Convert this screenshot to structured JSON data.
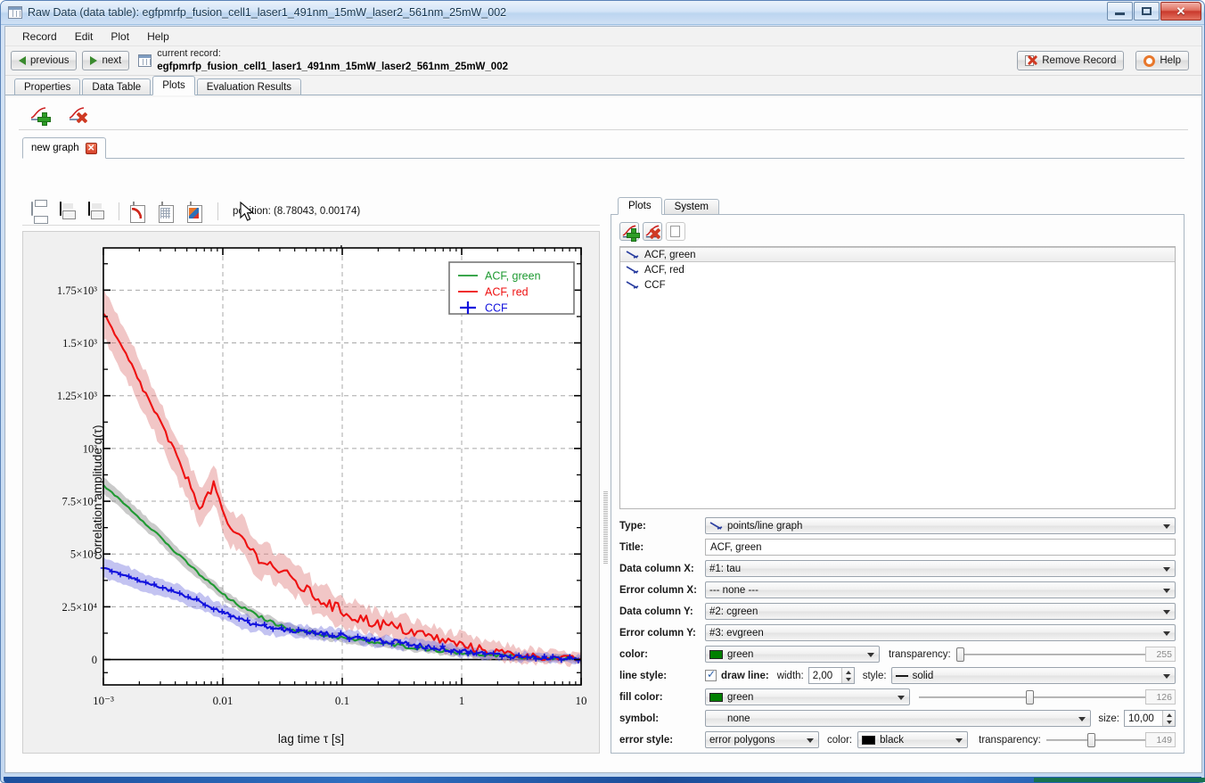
{
  "window": {
    "title": "Raw Data (data table): egfpmrfp_fusion_cell1_laser1_491nm_15mW_laser2_561nm_25mW_002",
    "minimize_label": "",
    "maximize_label": "",
    "close_label": "✕"
  },
  "menu": {
    "items": [
      "Record",
      "Edit",
      "Plot",
      "Help"
    ]
  },
  "record_bar": {
    "previous_label": "previous",
    "next_label": "next",
    "current_record_caption": "current record:",
    "current_record_name": "egfpmrfp_fusion_cell1_laser1_491nm_15mW_laser2_561nm_25mW_002",
    "remove_record_label": "Remove Record",
    "help_label": "Help"
  },
  "main_tabs": {
    "items": [
      "Properties",
      "Data Table",
      "Plots",
      "Evaluation Results"
    ],
    "active": "Plots"
  },
  "graph_tab": {
    "label": "new graph",
    "close_label": "✕"
  },
  "graph_toolbar": {
    "position_text": "position: (8.78043, 0.00174)",
    "icons": [
      "print-icon",
      "save-icon",
      "save-table-icon",
      "copy-graph-icon",
      "copy-table-icon",
      "copy-matlab-icon"
    ]
  },
  "right_tabs": {
    "items": [
      "Plots",
      "System"
    ],
    "active": "Plots"
  },
  "plot_list": {
    "items": [
      {
        "label": "ACF, green",
        "selected": true
      },
      {
        "label": "ACF, red",
        "selected": false
      },
      {
        "label": "CCF",
        "selected": false
      }
    ]
  },
  "form": {
    "type": {
      "label": "Type:",
      "value": "points/line graph"
    },
    "title": {
      "label": "Title:",
      "value": "ACF, green"
    },
    "data_column_x": {
      "label": "Data column X:",
      "value": "#1: tau"
    },
    "error_column_x": {
      "label": "Error column X:",
      "value": "--- none ---"
    },
    "data_column_y": {
      "label": "Data column Y:",
      "value": "#2: cgreen"
    },
    "error_column_y": {
      "label": "Error column Y:",
      "value": "#3: evgreen"
    },
    "color": {
      "label": "color:",
      "value": "green",
      "hex": "#008000"
    },
    "color_transparency": {
      "label": "transparency:",
      "value": "255",
      "percent": 2
    },
    "line_style": {
      "label": "line style:",
      "draw_line_label": "draw line:",
      "draw_line_checked": true,
      "width_label": "width:",
      "width_value": "2,00",
      "style_label": "style:",
      "style_value": "solid"
    },
    "fill_color": {
      "label": "fill color:",
      "value": "green",
      "hex": "#008000",
      "alpha": "126",
      "percent": 49
    },
    "symbol": {
      "label": "symbol:",
      "value": "none",
      "size_label": "size:",
      "size_value": "10,00"
    },
    "error_style": {
      "label": "error style:",
      "value": "error polygons",
      "color_label": "color:",
      "color_value": "black",
      "color_hex": "#000000",
      "transparency_label": "transparency:",
      "transparency_value": "149",
      "percent": 45
    }
  },
  "chart_data": {
    "type": "line",
    "title": "new graph",
    "xlabel": "lag time τ [s]",
    "ylabel": "correlation amplitude g(τ)",
    "xscale": "log",
    "xlim": [
      0.001,
      10
    ],
    "ylim": [
      -0.00012,
      0.00195
    ],
    "xticks": [
      "10⁻³",
      "0.01",
      "0.1",
      "1",
      "10"
    ],
    "xtick_values": [
      0.001,
      0.01,
      0.1,
      1,
      10
    ],
    "yticks": [
      "0",
      "2.5×10⁴",
      "5×10⁴",
      "7.5×10⁴",
      "10³",
      "1.25×10³",
      "1.5×10³",
      "1.75×10³"
    ],
    "ytick_values": [
      0,
      0.00025,
      0.0005,
      0.00075,
      0.001,
      0.00125,
      0.0015,
      0.00175
    ],
    "grid": true,
    "legend_position": "top-right",
    "series": [
      {
        "name": "ACF, green",
        "color": "#1f9a32",
        "error_color": "#8a8a8a",
        "symbol": "none",
        "x": [
          0.001,
          0.0013,
          0.0017,
          0.0022,
          0.0029,
          0.0038,
          0.005,
          0.0065,
          0.0085,
          0.011,
          0.0145,
          0.019,
          0.025,
          0.032,
          0.042,
          0.055,
          0.072,
          0.095,
          0.125,
          0.16,
          0.21,
          0.28,
          0.37,
          0.48,
          0.63,
          0.83,
          1.1,
          1.4,
          1.9,
          2.5,
          3.3,
          4.3,
          5.6,
          7.4,
          10
        ],
        "y": [
          0.000825,
          0.00077,
          0.00071,
          0.00065,
          0.00059,
          0.00052,
          0.00046,
          0.0004,
          0.000345,
          0.00029,
          0.000248,
          0.000212,
          0.00018,
          0.000155,
          0.000138,
          0.000126,
          0.000115,
          0.000105,
          9.5e-05,
          8.6e-05,
          7.7e-05,
          6.8e-05,
          6e-05,
          5.2e-05,
          4.4e-05,
          3.7e-05,
          3e-05,
          2.4e-05,
          1.9e-05,
          1.5e-05,
          1.1e-05,
          8.5e-06,
          6e-06,
          4e-06,
          2e-06
        ],
        "yerr": [
          4e-05,
          3.9e-05,
          3.8e-05,
          3.6e-05,
          3.5e-05,
          3.3e-05,
          3.1e-05,
          3e-05,
          2.8e-05,
          2.7e-05,
          2.6e-05,
          2.5e-05,
          2.4e-05,
          2.3e-05,
          2.25e-05,
          2.2e-05,
          2.15e-05,
          2.1e-05,
          2.1e-05,
          2.05e-05,
          2e-05,
          2e-05,
          1.95e-05,
          1.95e-05,
          1.9e-05,
          1.9e-05,
          1.85e-05,
          1.85e-05,
          1.8e-05,
          1.8e-05,
          1.75e-05,
          1.75e-05,
          1.7e-05,
          1.7e-05,
          1.65e-05
        ]
      },
      {
        "name": "ACF, red",
        "color": "#ee1111",
        "error_color": "#e08080",
        "symbol": "none",
        "x": [
          0.001,
          0.0013,
          0.0017,
          0.0022,
          0.0029,
          0.0038,
          0.005,
          0.0065,
          0.0085,
          0.011,
          0.0145,
          0.019,
          0.025,
          0.032,
          0.042,
          0.055,
          0.072,
          0.095,
          0.125,
          0.16,
          0.21,
          0.28,
          0.37,
          0.48,
          0.63,
          0.83,
          1.1,
          1.4,
          1.9,
          2.5,
          3.3,
          4.3,
          5.6,
          7.4,
          10
        ],
        "y": [
          0.00164,
          0.00152,
          0.0014,
          0.00127,
          0.00114,
          0.001,
          0.00086,
          0.00072,
          0.00083,
          0.00062,
          0.00058,
          0.00049,
          0.00045,
          0.00041,
          0.00036,
          0.00031,
          0.00027,
          0.000235,
          0.000205,
          0.000185,
          0.000168,
          0.000152,
          0.000135,
          0.000118,
          9.8e-05,
          8e-05,
          6.3e-05,
          5e-05,
          3.8e-05,
          2.8e-05,
          2e-05,
          1.4e-05,
          1e-05,
          6e-06,
          3e-06
        ],
        "yerr": [
          0.00012,
          0.000115,
          0.000112,
          0.000108,
          0.000105,
          0.0001,
          9.8e-05,
          9.5e-05,
          9.2e-05,
          9e-05,
          8.8e-05,
          8.5e-05,
          8.2e-05,
          8e-05,
          7.8e-05,
          7.5e-05,
          7.2e-05,
          7e-05,
          6.8e-05,
          6.5e-05,
          6.2e-05,
          6e-05,
          5.8e-05,
          5.5e-05,
          5.2e-05,
          5e-05,
          4.8e-05,
          4.5e-05,
          4.2e-05,
          4e-05,
          3.8e-05,
          3.5e-05,
          3.2e-05,
          3e-05,
          2.8e-05
        ]
      },
      {
        "name": "CCF",
        "color": "#1111dd",
        "error_color": "#7b7be0",
        "symbol": "plus",
        "x": [
          0.001,
          0.0013,
          0.0017,
          0.0022,
          0.0029,
          0.0038,
          0.005,
          0.0065,
          0.0085,
          0.011,
          0.0145,
          0.019,
          0.025,
          0.032,
          0.042,
          0.055,
          0.072,
          0.095,
          0.125,
          0.16,
          0.21,
          0.28,
          0.37,
          0.48,
          0.63,
          0.83,
          1.1,
          1.4,
          1.9,
          2.5,
          3.3,
          4.3,
          5.6,
          7.4,
          10
        ],
        "y": [
          0.000435,
          0.00041,
          0.00039,
          0.000365,
          0.000345,
          0.000325,
          0.0003,
          0.000275,
          0.000245,
          0.000215,
          0.000185,
          0.000165,
          0.000152,
          0.000142,
          0.000135,
          0.000128,
          0.000122,
          0.000114,
          0.000106,
          9.8e-05,
          9e-05,
          8.2e-05,
          7.3e-05,
          6.4e-05,
          5.5e-05,
          4.6e-05,
          3.8e-05,
          3e-05,
          2.3e-05,
          1.8e-05,
          1.3e-05,
          1e-05,
          7e-06,
          4e-06,
          2e-06
        ],
        "yerr": [
          5e-05,
          4.8e-05,
          4.6e-05,
          4.5e-05,
          4.3e-05,
          4.2e-05,
          4e-05,
          3.9e-05,
          3.8e-05,
          3.7e-05,
          3.6e-05,
          3.5e-05,
          3.4e-05,
          3.3e-05,
          3.2e-05,
          3.1e-05,
          3e-05,
          2.9e-05,
          2.9e-05,
          2.8e-05,
          2.8e-05,
          2.7e-05,
          2.7e-05,
          2.6e-05,
          2.6e-05,
          2.5e-05,
          2.5e-05,
          2.4e-05,
          2.4e-05,
          2.3e-05,
          2.3e-05,
          2.2e-05,
          2.2e-05,
          2.1e-05,
          2.1e-05
        ]
      }
    ]
  }
}
